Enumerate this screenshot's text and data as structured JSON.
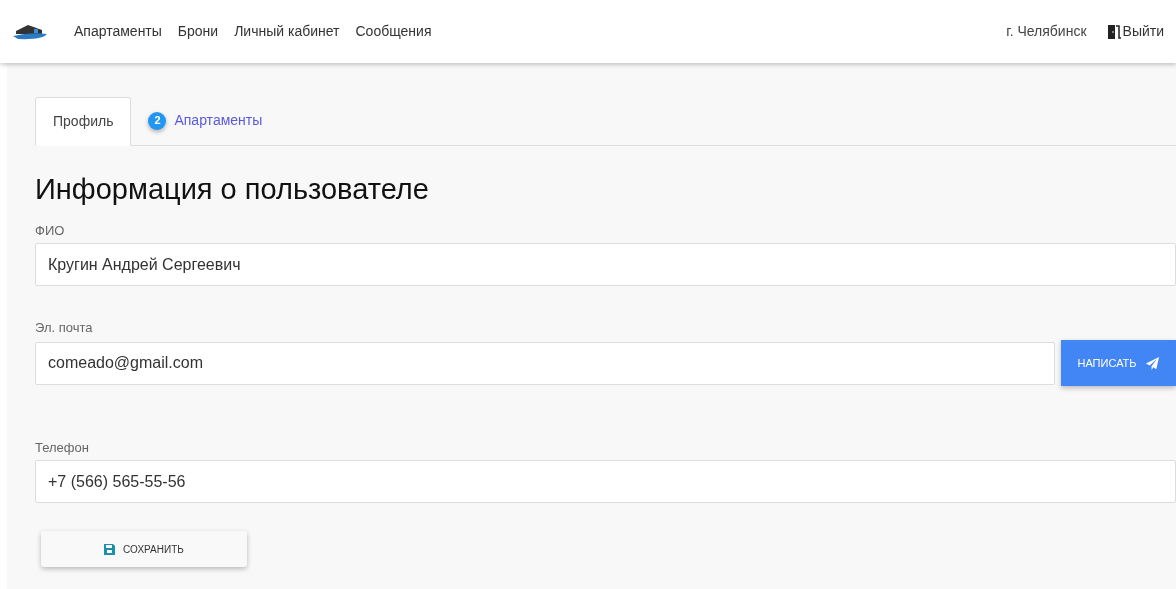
{
  "navbar": {
    "menu": [
      {
        "label": "Апартаменты"
      },
      {
        "label": "Брони"
      },
      {
        "label": "Личный кабинет"
      },
      {
        "label": "Сообщения"
      }
    ],
    "city": "г. Челябинск",
    "logout": "Выйти"
  },
  "tabs": [
    {
      "label": "Профиль",
      "selected": true
    },
    {
      "label": "Апартаменты",
      "badge": "2",
      "selected": false
    }
  ],
  "heading": "Информация о пользователе",
  "fields": [
    {
      "label": "ФИО",
      "value": "Кругин Андрей Сергеевич"
    },
    {
      "label": "Эл. почта",
      "value": "comeado@gmail.com",
      "action": "НАПИСАТЬ"
    },
    {
      "label": "Телефон",
      "value": "+7 (566) 565-55-56"
    }
  ],
  "save_button": "СОХРАНИТЬ"
}
